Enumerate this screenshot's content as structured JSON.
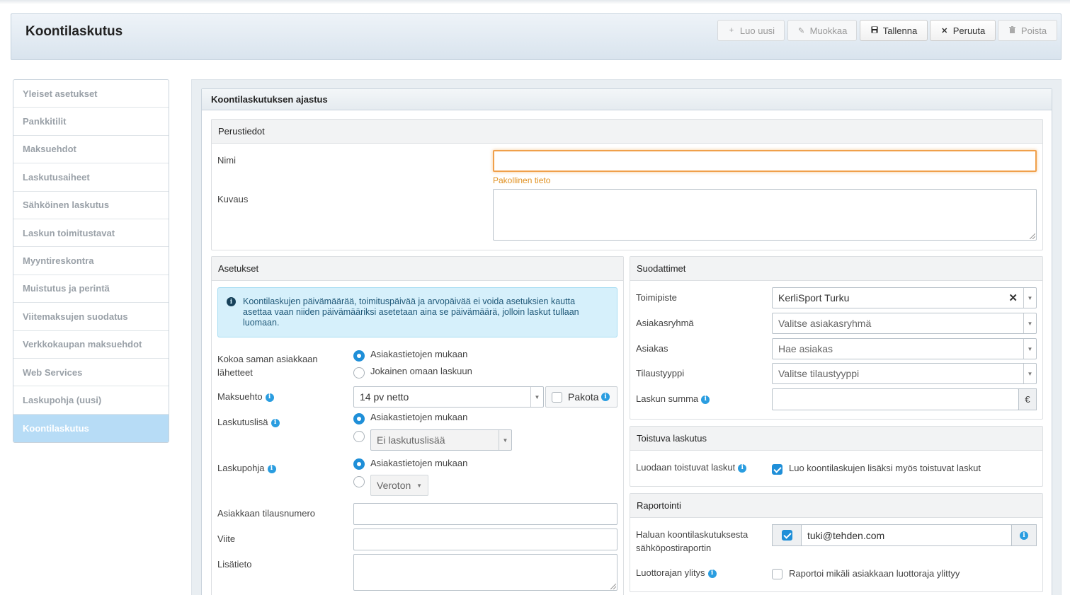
{
  "page": {
    "title": "Koontilaskutus"
  },
  "toolbar": {
    "new_label": "Luo uusi",
    "edit_label": "Muokkaa",
    "save_label": "Tallenna",
    "cancel_label": "Peruuta",
    "delete_label": "Poista"
  },
  "sidebar": {
    "items": [
      {
        "label": "Yleiset asetukset"
      },
      {
        "label": "Pankkitilit"
      },
      {
        "label": "Maksuehdot"
      },
      {
        "label": "Laskutusaiheet"
      },
      {
        "label": "Sähköinen laskutus"
      },
      {
        "label": "Laskun toimitustavat"
      },
      {
        "label": "Myyntireskontra"
      },
      {
        "label": "Muistutus ja perintä"
      },
      {
        "label": "Viitemaksujen suodatus"
      },
      {
        "label": "Verkkokaupan maksuehdot"
      },
      {
        "label": "Web Services"
      },
      {
        "label": "Laskupohja (uusi)"
      },
      {
        "label": "Koontilaskutus"
      }
    ]
  },
  "panel": {
    "title": "Koontilaskutuksen ajastus"
  },
  "basic": {
    "title": "Perustiedot",
    "name_label": "Nimi",
    "name_value": "",
    "required_text": "Pakollinen tieto",
    "description_label": "Kuvaus",
    "description_value": ""
  },
  "settings": {
    "title": "Asetukset",
    "alert_text": "Koontilaskujen päivämäärää, toimituspäivää ja arvopäivää ei voida asetuksien kautta asettaa vaan niiden päivämääriksi asetetaan aina se päivämäärä, jolloin laskut tullaan luomaan.",
    "combine_label_1": "Kokoa saman asiakkaan",
    "combine_label_2": "lähetteet",
    "combine_opt1": "Asiakastietojen mukaan",
    "combine_opt2": "Jokainen omaan laskuun",
    "payment_term_label": "Maksuehto",
    "payment_term_value": "14 pv netto",
    "force_label": "Pakota",
    "billing_extra_label": "Laskutuslisä",
    "billing_extra_opt1": "Asiakastietojen mukaan",
    "billing_extra_select": "Ei laskutuslisää",
    "template_label": "Laskupohja",
    "template_opt1": "Asiakastietojen mukaan",
    "template_select": "Veroton",
    "order_number_label": "Asiakkaan tilausnumero",
    "order_number_value": "",
    "reference_label": "Viite",
    "reference_value": "",
    "extra_info_label": "Lisätieto",
    "extra_info_value": ""
  },
  "filters": {
    "title": "Suodattimet",
    "office_label": "Toimipiste",
    "office_value": "KerliSport Turku",
    "customer_group_label": "Asiakasryhmä",
    "customer_group_placeholder": "Valitse asiakasryhmä",
    "customer_label": "Asiakas",
    "customer_placeholder": "Hae asiakas",
    "order_type_label": "Tilaustyyppi",
    "order_type_placeholder": "Valitse tilaustyyppi",
    "invoice_sum_label": "Laskun summa",
    "invoice_sum_value": "",
    "currency": "€"
  },
  "recurring": {
    "title": "Toistuva laskutus",
    "label": "Luodaan toistuvat laskut",
    "checkbox_label": "Luo koontilaskujen lisäksi myös toistuvat laskut",
    "checked": true
  },
  "reporting": {
    "title": "Raportointi",
    "email_label_1": "Haluan koontilaskutuksesta",
    "email_label_2": "sähköpostiraportin",
    "email_value": "tuki@tehden.com",
    "credit_label": "Luottorajan ylitys",
    "credit_checkbox_label": "Raportoi mikäli asiakkaan luottoraja ylittyy"
  },
  "colors": {
    "accent": "#1f8fd8",
    "active_nav": "#b7dcf6",
    "required": "#f0a04b",
    "alert_bg": "#d6f0fb"
  },
  "icons": {
    "new": "plus-icon",
    "edit": "pencil-icon",
    "save": "floppy-icon",
    "cancel": "close-icon",
    "delete": "trash-icon",
    "info": "info-icon"
  }
}
